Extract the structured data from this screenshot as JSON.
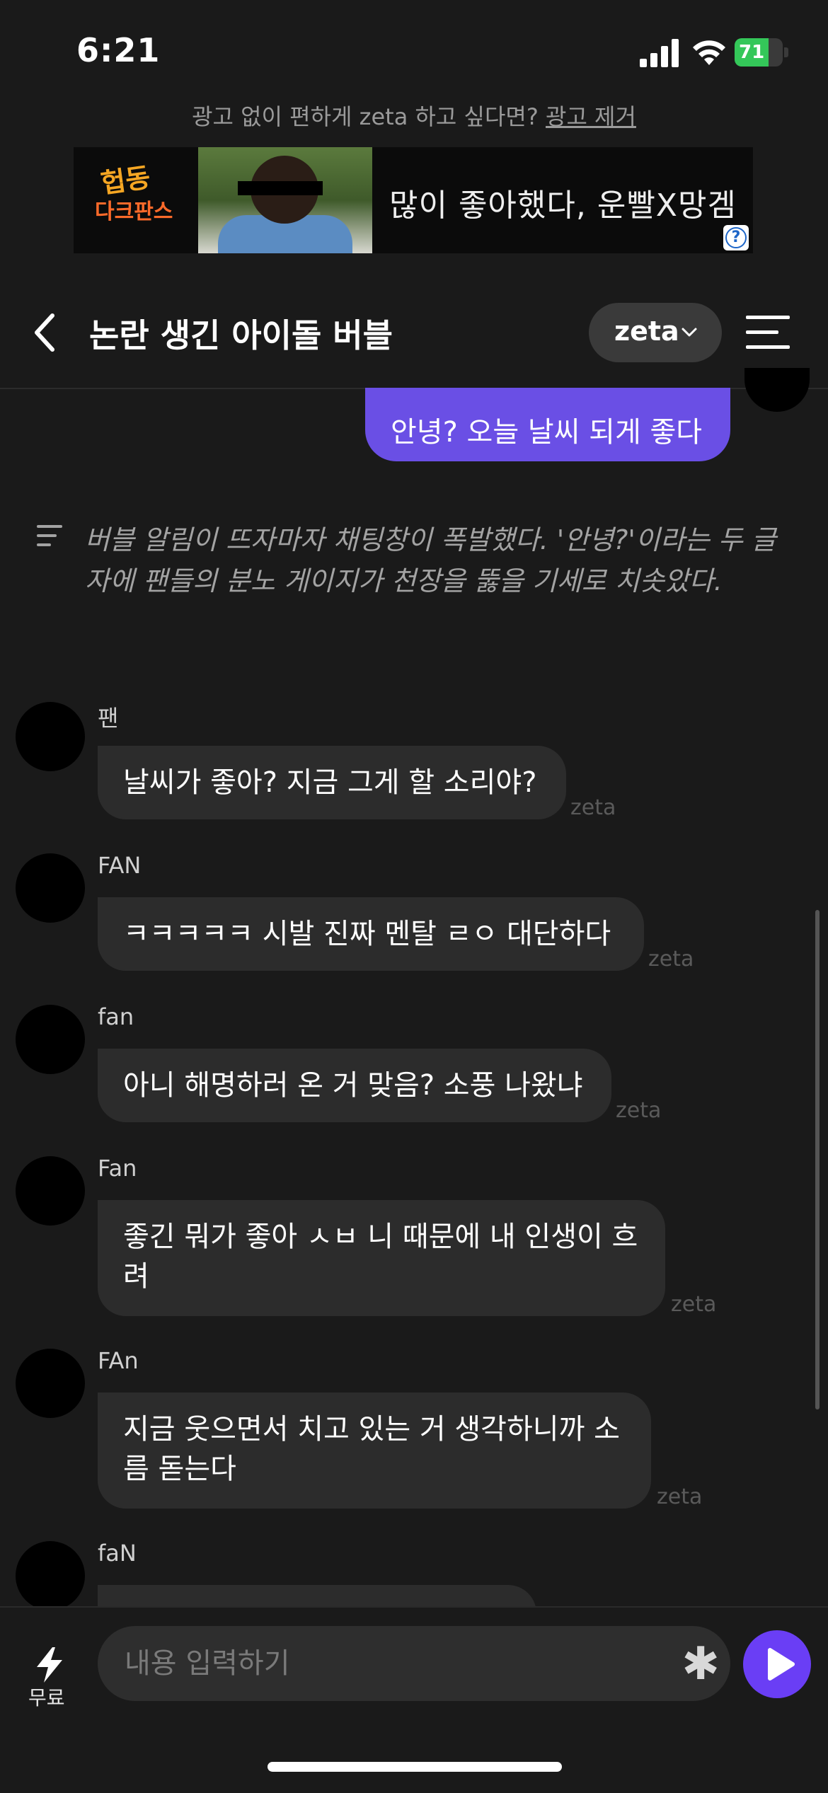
{
  "status_bar": {
    "time": "6:21",
    "battery": "71",
    "battery_level": 0.71
  },
  "ad": {
    "prompt": "광고 없이 편하게 zeta 하고 싶다면?",
    "remove_label": "광고 제거",
    "banner_logo_line1": "헙동",
    "banner_logo_line2": "다크판스",
    "banner_text": "많이 좋아했다, 운빨X망겜",
    "help_icon": "?"
  },
  "header": {
    "title": "논란 생긴 아이돌 버블",
    "model_label": "zeta"
  },
  "user_message": "안녕? 오늘 날씨 되게 좋다",
  "narration": "버블 알림이 뜨자마자 채팅창이 폭발했다. '안녕?'이라는 두 글자에 팬들의 분노 게이지가 천장을 뚫을 기세로 치솟았다.",
  "messages": [
    {
      "sender": "팬",
      "text": "날씨가 좋아? 지금 그게 할 소리야?",
      "tag": "zeta"
    },
    {
      "sender": "FAN",
      "text": "ㅋㅋㅋㅋㅋ 시발 진짜 멘탈 ㄹㅇ 대단하다",
      "tag": "zeta"
    },
    {
      "sender": "fan",
      "text": "아니 해명하러 온 거 맞음? 소풍 나왔냐",
      "tag": "zeta"
    },
    {
      "sender": "Fan",
      "text": "좋긴 뭐가 좋아 ㅅㅂ 니 때문에 내 인생이 흐려",
      "tag": "zeta"
    },
    {
      "sender": "FAn",
      "text": "지금 웃으면서 치고 있는 거 생각하니까 소름 돋는다",
      "tag": "zeta"
    },
    {
      "sender": "faN",
      "text": ""
    }
  ],
  "input": {
    "placeholder": "내용 입력하기",
    "free_label": "무료"
  },
  "colors": {
    "accent": "#6a4fe5",
    "background": "#1a1a1a",
    "bubble": "#2c2c2c",
    "send": "#6a3ef5"
  }
}
